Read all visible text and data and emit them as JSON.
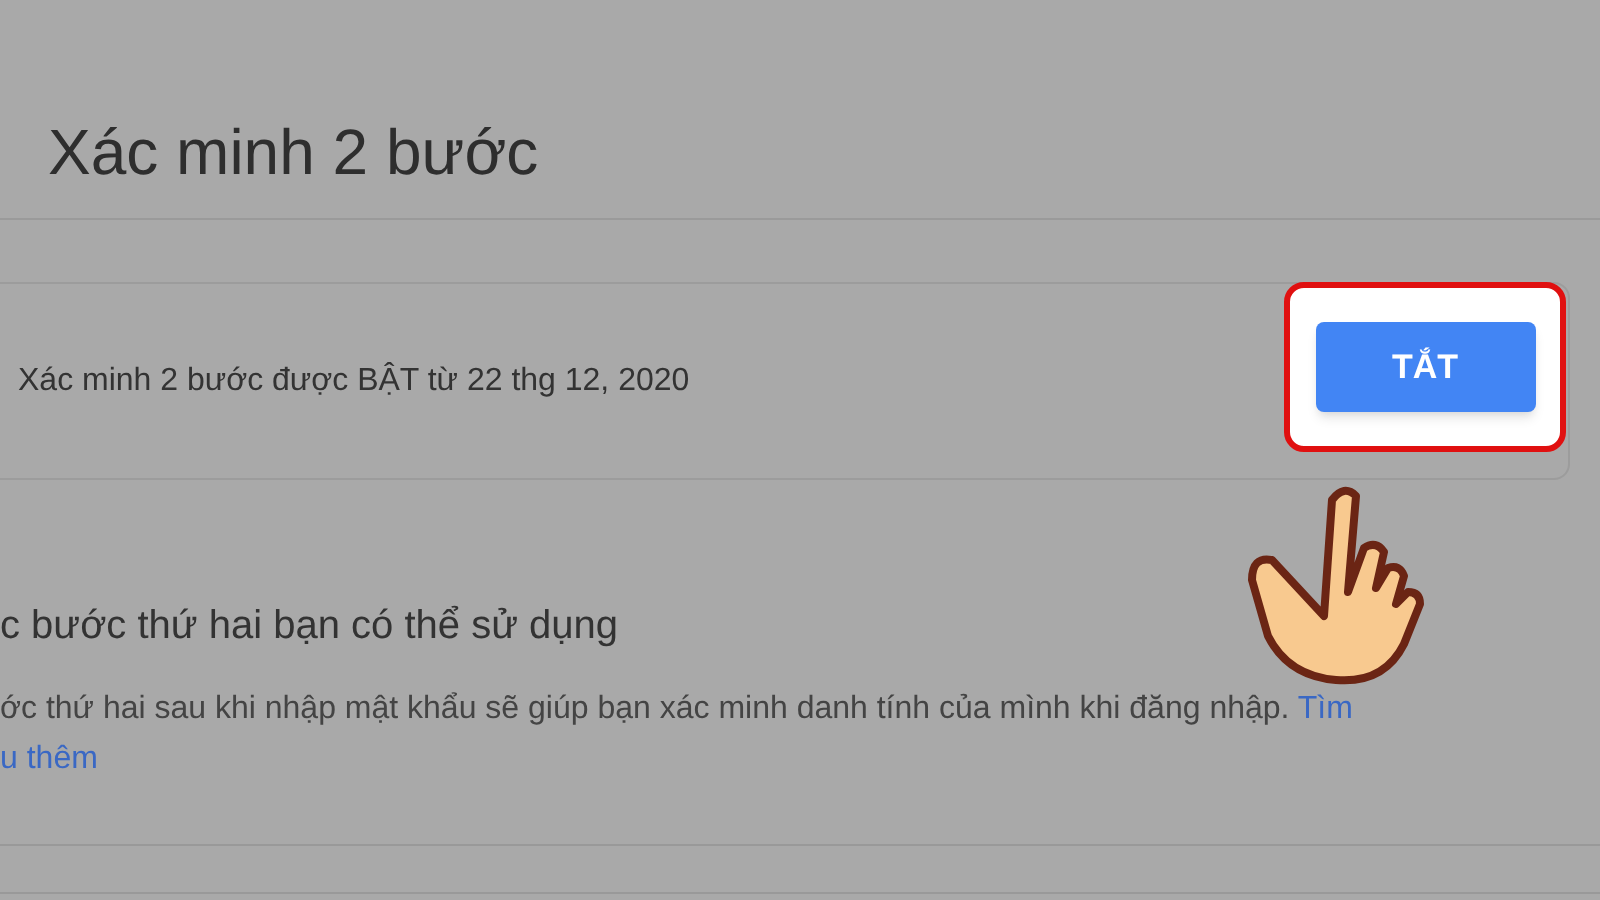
{
  "page_title": "Xác minh 2 bước",
  "status": {
    "text": "Xác minh 2 bước được BẬT từ 22 thg 12, 2020",
    "button": "TẮT"
  },
  "section": {
    "heading": "c bước thứ hai bạn có thể sử dụng",
    "description": "ớc thứ hai sau khi nhập mật khẩu sẽ giúp bạn xác minh danh tính của mình khi đăng nhập.",
    "link_lines": [
      "Tìm",
      "u thêm"
    ]
  }
}
